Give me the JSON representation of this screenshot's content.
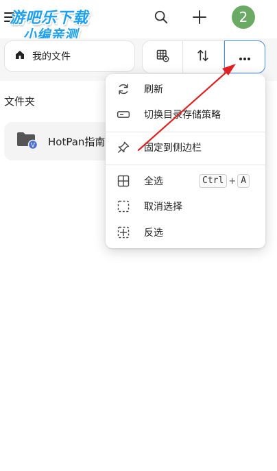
{
  "watermark": {
    "line1": "游吧乐下载",
    "line2": "小编亲测"
  },
  "topbar": {
    "avatar_text": "2"
  },
  "toolbar": {
    "breadcrumb_label": "我的文件"
  },
  "content": {
    "section_title": "文件夹",
    "folders": [
      {
        "name": "HotPan指南"
      }
    ]
  },
  "menu": {
    "items": [
      {
        "label": "刷新",
        "icon": "refresh-icon"
      },
      {
        "label": "切换目录存储策略",
        "icon": "storage-icon"
      },
      {
        "label": "固定到侧边栏",
        "icon": "pin-icon"
      },
      {
        "label": "全选",
        "icon": "select-all-icon",
        "shortcut": [
          "Ctrl",
          "A"
        ]
      },
      {
        "label": "取消选择",
        "icon": "deselect-icon"
      },
      {
        "label": "反选",
        "icon": "invert-selection-icon"
      }
    ],
    "shortcut_plus": "+"
  },
  "colors": {
    "accent": "#4a8fe0",
    "avatar": "#6aaa64",
    "annotation": "#e02020",
    "watermark": "#1ea0f0"
  }
}
